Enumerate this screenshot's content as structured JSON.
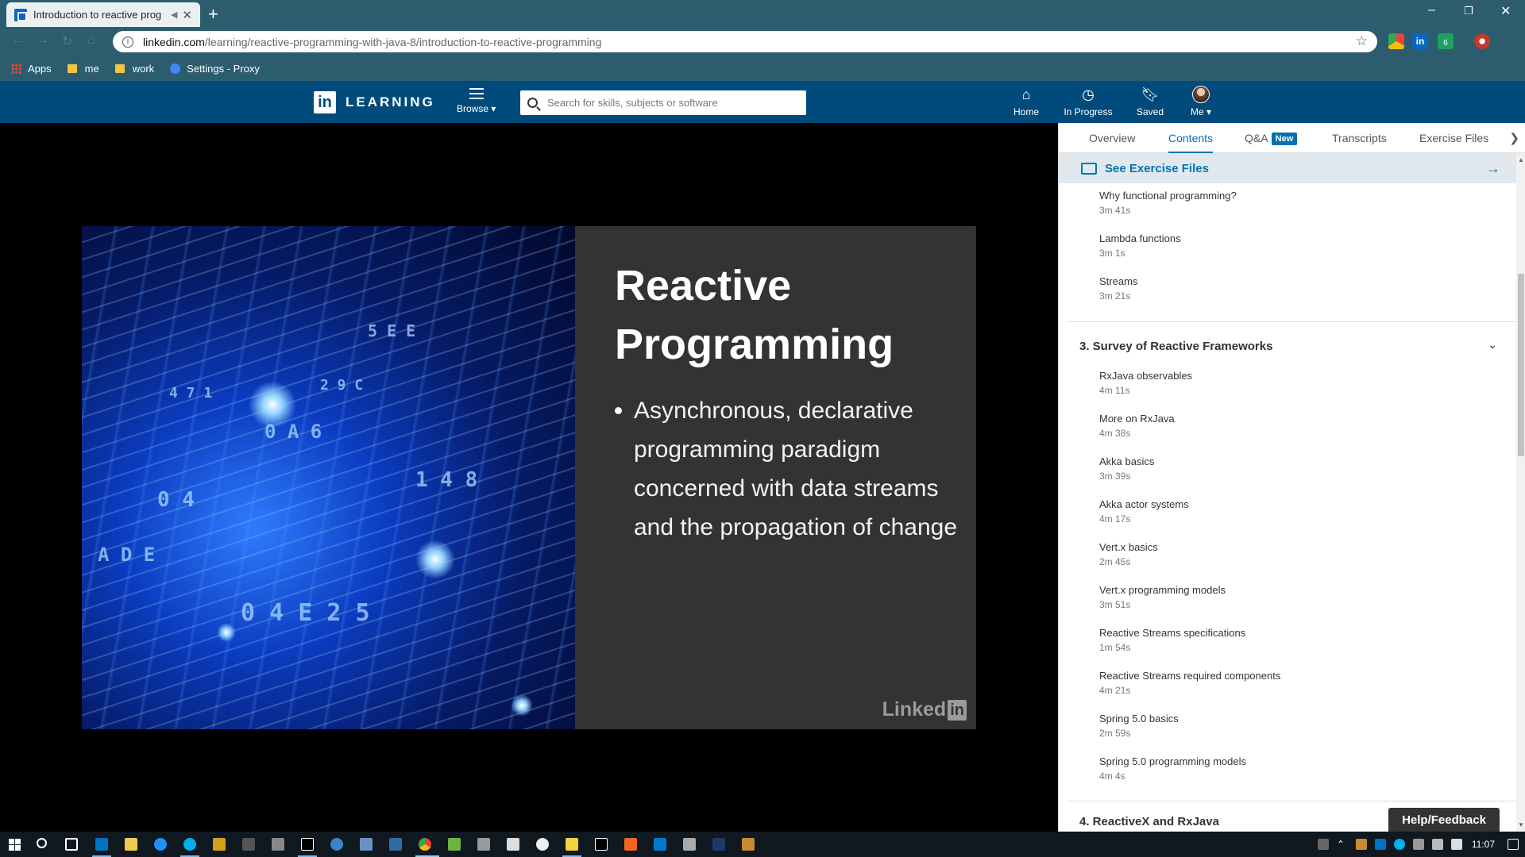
{
  "browser": {
    "tab_title": "Introduction to reactive prog",
    "url_host": "linkedin.com",
    "url_path": "/learning/reactive-programming-with-java-8/introduction-to-reactive-programming",
    "bookmarks": [
      "Apps",
      "me",
      "work",
      "Settings - Proxy"
    ],
    "ext_badge": "6"
  },
  "header": {
    "logo_text": "LEARNING",
    "browse_label": "Browse ▾",
    "search_placeholder": "Search for skills, subjects or software",
    "nav": [
      "Home",
      "In Progress",
      "Saved",
      "Me ▾"
    ]
  },
  "slide": {
    "title_line1": "Reactive",
    "title_line2": "Programming",
    "bullet": "Asynchronous, declarative programming paradigm concerned with data streams and the propagation of change",
    "watermark": "Linked",
    "watermark_in": "in"
  },
  "panel": {
    "tabs": [
      "Overview",
      "Contents",
      "Q&A",
      "Transcripts",
      "Exercise Files"
    ],
    "new_badge": "New",
    "exercise_files": "See Exercise Files",
    "section2_items": [
      {
        "name": "Why functional programming?",
        "duration": "3m 41s"
      },
      {
        "name": "Lambda functions",
        "duration": "3m 1s"
      },
      {
        "name": "Streams",
        "duration": "3m 21s"
      }
    ],
    "section3_title": "3. Survey of Reactive Frameworks",
    "section3_items": [
      {
        "name": "RxJava observables",
        "duration": "4m 11s"
      },
      {
        "name": "More on RxJava",
        "duration": "4m 38s"
      },
      {
        "name": "Akka basics",
        "duration": "3m 39s"
      },
      {
        "name": "Akka actor systems",
        "duration": "4m 17s"
      },
      {
        "name": "Vert.x basics",
        "duration": "2m 45s"
      },
      {
        "name": "Vert.x programming models",
        "duration": "3m 51s"
      },
      {
        "name": "Reactive Streams specifications",
        "duration": "1m 54s"
      },
      {
        "name": "Reactive Streams required components",
        "duration": "4m 21s"
      },
      {
        "name": "Spring 5.0 basics",
        "duration": "2m 59s"
      },
      {
        "name": "Spring 5.0 programming models",
        "duration": "4m 4s"
      }
    ],
    "section4_title": "4. ReactiveX and RxJava",
    "help_label": "Help/Feedback"
  },
  "taskbar": {
    "clock": "11:07"
  }
}
